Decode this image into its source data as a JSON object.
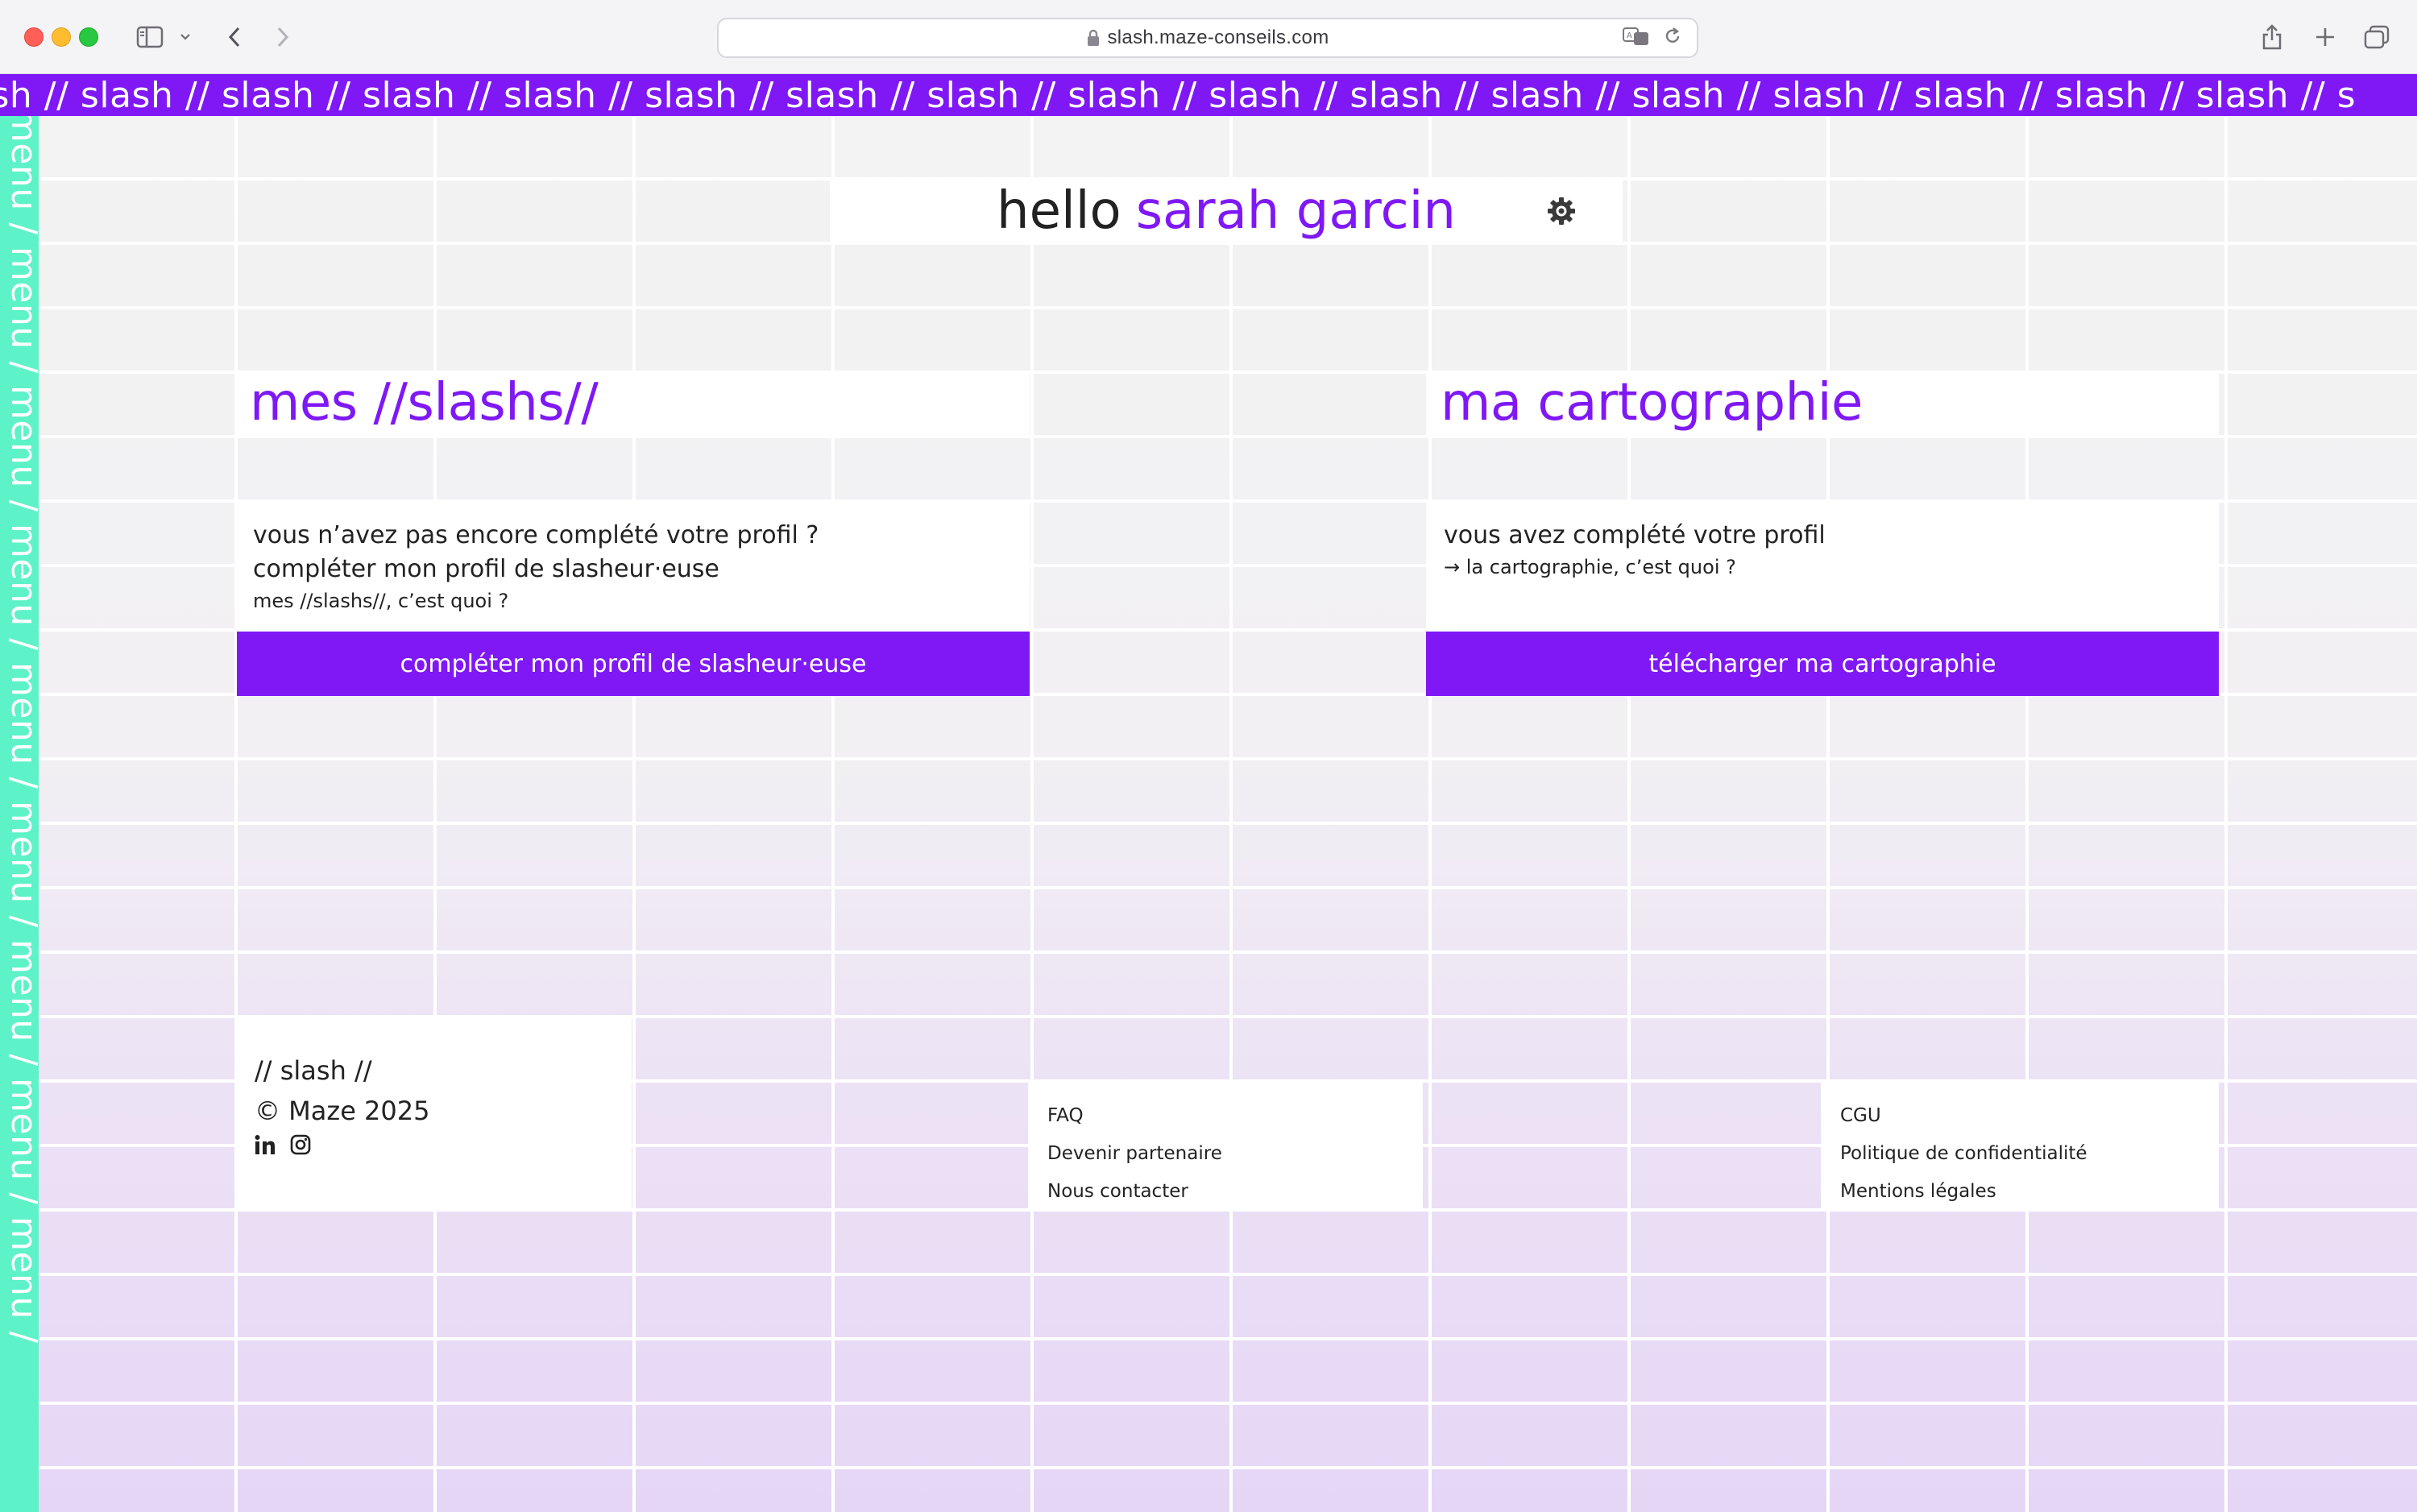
{
  "browser": {
    "url": "slash.maze-conseils.com"
  },
  "marquee": {
    "items": [
      "sh //",
      "slash //",
      "slash //",
      "slash //",
      "slash //",
      "slash //",
      "slash //",
      "slash //",
      "slash //",
      "slash //",
      "slash //",
      "slash //",
      "slash //",
      "slash //",
      "slash //",
      "slash //",
      "slash //",
      "s"
    ]
  },
  "side_menu": {
    "items": [
      "menu /",
      "menu /",
      "menu /",
      "menu /",
      "menu /",
      "menu /",
      "menu /",
      "menu /",
      "menu /"
    ]
  },
  "greeting": {
    "hello": "hello",
    "name": "sarah garcin"
  },
  "slashs": {
    "title": "mes //slashs//",
    "line1": "vous n’avez pas encore complété votre profil ?",
    "line2": "compléter mon profil de slasheur·euse",
    "line3": "mes //slashs//, c’est quoi ?",
    "button": "compléter mon profil de slasheur·euse"
  },
  "cartographie": {
    "title": "ma cartographie",
    "line1": "vous avez complété votre profil",
    "line2": "→ la cartographie, c’est quoi ?",
    "button": "télécharger ma cartographie"
  },
  "footer": {
    "brand": "// slash //",
    "copyright": "© Maze 2025",
    "links_left": [
      "FAQ",
      "Devenir partenaire",
      "Nous contacter"
    ],
    "links_right": [
      "CGU",
      "Politique de confidentialité",
      "Mentions légales"
    ]
  },
  "colors": {
    "accent": "#7f18f5",
    "menu": "#5ef2c9",
    "grid_top": "#f3f3f3",
    "grid_bottom": "#e6d6f6"
  }
}
